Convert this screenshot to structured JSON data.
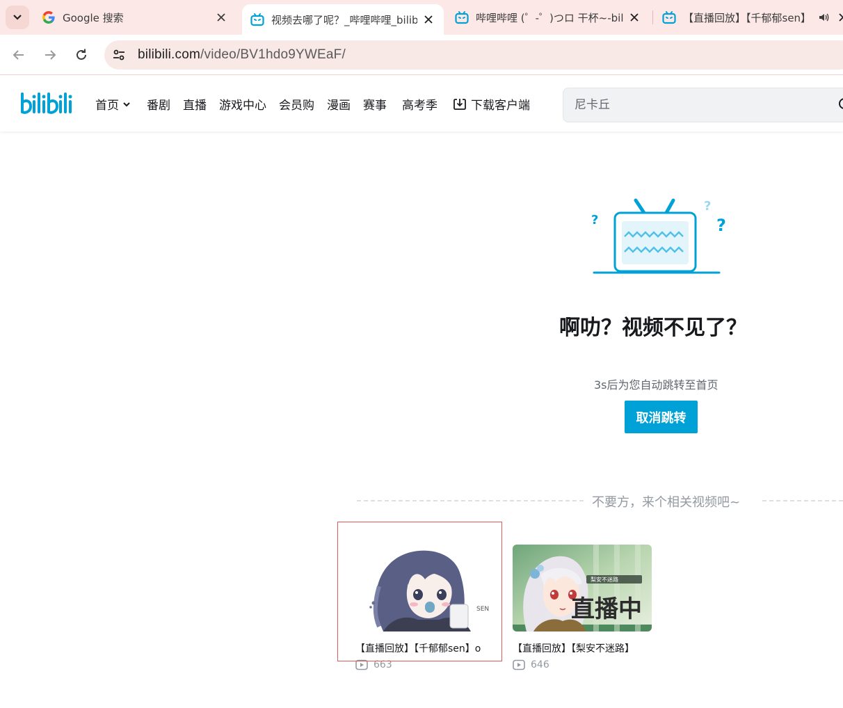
{
  "browser": {
    "tabs": [
      {
        "title": "Google 搜索",
        "icon": "google-icon"
      },
      {
        "title": "视频去哪了呢？_哔哩哔哩_bilibili",
        "icon": "bilibili-tv-icon",
        "active": true
      },
      {
        "title": "哔哩哔哩 (゜-゜)つロ 干杯~-bilibili",
        "icon": "bilibili-tv-icon"
      },
      {
        "title": "【直播回放】【千郁郁sen】",
        "icon": "bilibili-tv-icon",
        "audio": true
      }
    ],
    "url_host": "bilibili.com",
    "url_path": "/video/BV1hdo9YWEaF/"
  },
  "header": {
    "nav": [
      {
        "label": "首页",
        "has_dropdown": true
      },
      {
        "label": "番剧"
      },
      {
        "label": "直播"
      },
      {
        "label": "游戏中心"
      },
      {
        "label": "会员购"
      },
      {
        "label": "漫画"
      },
      {
        "label": "赛事"
      },
      {
        "label": "高考季"
      },
      {
        "label": "下载客户端",
        "icon": "download-icon"
      }
    ],
    "search_placeholder": "尼卡丘"
  },
  "error": {
    "title": "啊叻？视频不见了？",
    "redirect_text": "3s后为您自动跳转至首页",
    "cancel_label": "取消跳转"
  },
  "related": {
    "heading": "不要方，来个相关视频吧~",
    "videos": [
      {
        "title": "【直播回放】【千郁郁sen】o",
        "views": "663",
        "thumb_text": "SEN"
      },
      {
        "title": "【直播回放】【梨安不迷路】",
        "views": "646",
        "thumb_text": "直播中",
        "thumb_sub": "梨安不迷路"
      }
    ]
  },
  "colors": {
    "brand": "#00a1d6",
    "tabstrip": "#fce8e6",
    "highlight": "#e05a5a"
  }
}
